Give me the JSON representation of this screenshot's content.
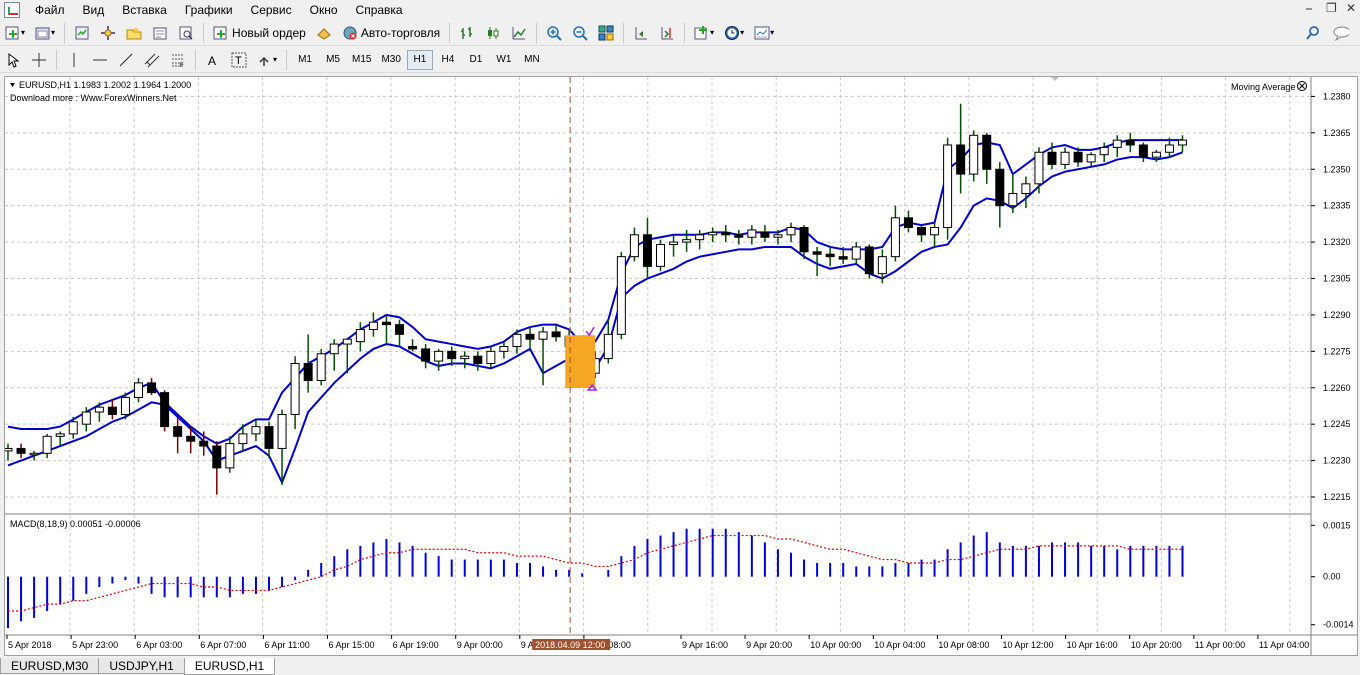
{
  "menu": [
    "Файл",
    "Вид",
    "Вставка",
    "Графики",
    "Сервис",
    "Окно",
    "Справка"
  ],
  "toolbar": {
    "new_order_label": "Новый ордер",
    "auto_trading_label": "Авто-торговля"
  },
  "timeframes": [
    "M1",
    "M5",
    "M15",
    "M30",
    "H1",
    "H4",
    "D1",
    "W1",
    "MN"
  ],
  "active_timeframe": "H1",
  "chart": {
    "symbol_header": "EURUSD,H1  1.1983 1.2002 1.1964 1.2000",
    "download_note": "Download more : Www.ForexWinners.Net",
    "indicator_name": "Moving Average",
    "price_ticks": [
      "1.2380",
      "1.2365",
      "1.2350",
      "1.2335",
      "1.2320",
      "1.2305",
      "1.2290",
      "1.2275",
      "1.2260",
      "1.2245",
      "1.2230",
      "1.2215"
    ],
    "macd_label": "MACD(8,18,9) 0.00051 -0.00006",
    "macd_ticks": [
      "0.0015",
      "0.00",
      "-0.0014"
    ],
    "time_labels": [
      "5 Apr 2018",
      "5 Apr 23:00",
      "6 Apr 03:00",
      "6 Apr 07:00",
      "6 Apr 11:00",
      "6 Apr 15:00",
      "6 Apr 19:00",
      "9 Apr 00:00",
      "9 Apr 04:00",
      "9 Apr 08:00",
      "9 Apr 16:00",
      "9 Apr 20:00",
      "10 Apr 00:00",
      "10 Apr 04:00",
      "10 Apr 08:00",
      "10 Apr 12:00",
      "10 Apr 16:00",
      "10 Apr 20:00",
      "11 Apr 00:00",
      "11 Apr 04:00"
    ],
    "cursor_time": "2018.04.09 12:00",
    "colors": {
      "bull": "#ffffff",
      "bear": "#000000",
      "ma": "#0000cc",
      "macd_hist": "#0000dd",
      "macd_signal": "#dd0000",
      "cursor": "#a0522d",
      "marker": "#f5a623"
    }
  },
  "chart_data": {
    "type": "candlestick",
    "price_range": [
      1.2208,
      1.2388
    ],
    "macd_range": [
      -0.0017,
      0.0018
    ],
    "candles": [
      [
        1.2234,
        1.2237,
        1.223,
        1.2235
      ],
      [
        1.2235,
        1.2237,
        1.2231,
        1.2233
      ],
      [
        1.2233,
        1.2234,
        1.223,
        1.2233
      ],
      [
        1.2233,
        1.2241,
        1.2231,
        1.224
      ],
      [
        1.224,
        1.2242,
        1.2236,
        1.2241
      ],
      [
        1.2241,
        1.2248,
        1.2239,
        1.2246
      ],
      [
        1.2245,
        1.2252,
        1.2242,
        1.225
      ],
      [
        1.225,
        1.2254,
        1.2246,
        1.2252
      ],
      [
        1.2252,
        1.2255,
        1.2247,
        1.2249
      ],
      [
        1.2249,
        1.2258,
        1.2247,
        1.2256
      ],
      [
        1.2256,
        1.2264,
        1.2254,
        1.2262
      ],
      [
        1.2262,
        1.2264,
        1.2257,
        1.2258
      ],
      [
        1.2258,
        1.2259,
        1.2242,
        1.2244
      ],
      [
        1.2244,
        1.2248,
        1.2233,
        1.224
      ],
      [
        1.224,
        1.2244,
        1.2233,
        1.2238
      ],
      [
        1.2238,
        1.2242,
        1.2232,
        1.2236
      ],
      [
        1.2236,
        1.2238,
        1.2216,
        1.2227
      ],
      [
        1.2227,
        1.224,
        1.2225,
        1.2237
      ],
      [
        1.2237,
        1.2245,
        1.2234,
        1.2241
      ],
      [
        1.2241,
        1.2247,
        1.2238,
        1.2244
      ],
      [
        1.2244,
        1.2246,
        1.2231,
        1.2235
      ],
      [
        1.2235,
        1.2251,
        1.222,
        1.2249
      ],
      [
        1.2249,
        1.2273,
        1.2243,
        1.227
      ],
      [
        1.227,
        1.2282,
        1.2258,
        1.2263
      ],
      [
        1.2263,
        1.2276,
        1.2261,
        1.2274
      ],
      [
        1.2274,
        1.228,
        1.2267,
        1.2278
      ],
      [
        1.2278,
        1.228,
        1.2266,
        1.228
      ],
      [
        1.2279,
        1.2287,
        1.2275,
        1.2284
      ],
      [
        1.2284,
        1.2291,
        1.2281,
        1.2287
      ],
      [
        1.2287,
        1.229,
        1.2278,
        1.2286
      ],
      [
        1.2286,
        1.2288,
        1.2277,
        1.2282
      ],
      [
        1.2277,
        1.228,
        1.2275,
        1.2276
      ],
      [
        1.2276,
        1.2278,
        1.2268,
        1.2271
      ],
      [
        1.2271,
        1.2276,
        1.2267,
        1.2275
      ],
      [
        1.2275,
        1.2277,
        1.2269,
        1.2272
      ],
      [
        1.2272,
        1.2275,
        1.2268,
        1.2273
      ],
      [
        1.2273,
        1.2275,
        1.2267,
        1.227
      ],
      [
        1.227,
        1.2277,
        1.2268,
        1.2275
      ],
      [
        1.2275,
        1.2279,
        1.2272,
        1.2277
      ],
      [
        1.2277,
        1.2284,
        1.2274,
        1.2282
      ],
      [
        1.2282,
        1.2285,
        1.2276,
        1.228
      ],
      [
        1.228,
        1.2285,
        1.2261,
        1.2283
      ],
      [
        1.2283,
        1.2286,
        1.2279,
        1.2281
      ],
      [
        1.2281,
        1.2284,
        1.2276,
        1.2277
      ],
      [
        1.2279,
        1.228,
        1.2264,
        1.2266
      ],
      [
        1.2266,
        1.2275,
        1.2264,
        1.2272
      ],
      [
        1.2272,
        1.2288,
        1.227,
        1.2282
      ],
      [
        1.2282,
        1.2316,
        1.228,
        1.2314
      ],
      [
        1.2314,
        1.2326,
        1.2312,
        1.2323
      ],
      [
        1.2323,
        1.233,
        1.2305,
        1.231
      ],
      [
        1.231,
        1.2321,
        1.2308,
        1.2319
      ],
      [
        1.2319,
        1.2323,
        1.2314,
        1.232
      ],
      [
        1.232,
        1.2325,
        1.2316,
        1.2321
      ],
      [
        1.2321,
        1.2325,
        1.2317,
        1.2323
      ],
      [
        1.2323,
        1.2326,
        1.232,
        1.2324
      ],
      [
        1.2324,
        1.2327,
        1.232,
        1.2323
      ],
      [
        1.2323,
        1.2325,
        1.2319,
        1.2322
      ],
      [
        1.2322,
        1.2327,
        1.2319,
        1.2325
      ],
      [
        1.2324,
        1.2327,
        1.232,
        1.2322
      ],
      [
        1.2322,
        1.2325,
        1.2319,
        1.2323
      ],
      [
        1.2323,
        1.2328,
        1.232,
        1.2326
      ],
      [
        1.2326,
        1.2327,
        1.2313,
        1.2316
      ],
      [
        1.2316,
        1.2318,
        1.2306,
        1.2315
      ],
      [
        1.2315,
        1.2318,
        1.231,
        1.2314
      ],
      [
        1.2314,
        1.2318,
        1.2311,
        1.2313
      ],
      [
        1.2313,
        1.232,
        1.2311,
        1.2318
      ],
      [
        1.2318,
        1.2319,
        1.2305,
        1.2307
      ],
      [
        1.2307,
        1.2317,
        1.2303,
        1.2314
      ],
      [
        1.2314,
        1.2335,
        1.2312,
        1.233
      ],
      [
        1.233,
        1.2333,
        1.2324,
        1.2326
      ],
      [
        1.2326,
        1.2327,
        1.232,
        1.2323
      ],
      [
        1.2323,
        1.2328,
        1.2318,
        1.2326
      ],
      [
        1.2326,
        1.2363,
        1.2321,
        1.236
      ],
      [
        1.236,
        1.2377,
        1.234,
        1.2348
      ],
      [
        1.2348,
        1.2366,
        1.2345,
        1.2364
      ],
      [
        1.2364,
        1.2365,
        1.2344,
        1.235
      ],
      [
        1.235,
        1.2353,
        1.2326,
        1.2335
      ],
      [
        1.2335,
        1.2348,
        1.2332,
        1.234
      ],
      [
        1.234,
        1.2347,
        1.2334,
        1.2344
      ],
      [
        1.2344,
        1.2359,
        1.234,
        1.2357
      ],
      [
        1.2357,
        1.2361,
        1.235,
        1.2352
      ],
      [
        1.2352,
        1.2359,
        1.235,
        1.2357
      ],
      [
        1.2357,
        1.2359,
        1.2351,
        1.2353
      ],
      [
        1.2353,
        1.2357,
        1.2351,
        1.2356
      ],
      [
        1.2356,
        1.2361,
        1.2353,
        1.2359
      ],
      [
        1.2359,
        1.2364,
        1.2355,
        1.2362
      ],
      [
        1.2362,
        1.2365,
        1.2357,
        1.236
      ],
      [
        1.236,
        1.2361,
        1.2353,
        1.2355
      ],
      [
        1.2355,
        1.2358,
        1.2353,
        1.2357
      ],
      [
        1.2357,
        1.2363,
        1.2355,
        1.236
      ],
      [
        1.236,
        1.2364,
        1.2357,
        1.2362
      ]
    ],
    "ma_upper": [
      1.2244,
      1.2243,
      1.2243,
      1.2243,
      1.2244,
      1.2247,
      1.225,
      1.2253,
      1.2255,
      1.2257,
      1.226,
      1.2262,
      1.2254,
      1.2249,
      1.2244,
      1.224,
      1.2237,
      1.2239,
      1.2244,
      1.2247,
      1.2247,
      1.2258,
      1.2264,
      1.227,
      1.2273,
      1.2276,
      1.228,
      1.2284,
      1.2287,
      1.229,
      1.2289,
      1.2285,
      1.228,
      1.2279,
      1.2278,
      1.2277,
      1.2276,
      1.2277,
      1.2279,
      1.2283,
      1.2285,
      1.2286,
      1.2286,
      1.2284,
      1.2278,
      1.2279,
      1.2288,
      1.2307,
      1.2318,
      1.2321,
      1.2322,
      1.2323,
      1.2323,
      1.2323,
      1.2324,
      1.2324,
      1.2323,
      1.2324,
      1.2324,
      1.2324,
      1.2326,
      1.2325,
      1.232,
      1.2318,
      1.2317,
      1.2317,
      1.2317,
      1.2318,
      1.2326,
      1.2328,
      1.2327,
      1.2328,
      1.235,
      1.2354,
      1.236,
      1.2361,
      1.236,
      1.2348,
      1.2352,
      1.2356,
      1.2359,
      1.236,
      1.2358,
      1.2358,
      1.2359,
      1.2361,
      1.2362,
      1.2362,
      1.2362,
      1.2362,
      1.2362
    ],
    "ma_lower": [
      1.2228,
      1.223,
      1.2232,
      1.2234,
      1.2236,
      1.2238,
      1.224,
      1.2243,
      1.2246,
      1.2248,
      1.2251,
      1.2254,
      1.2253,
      1.2248,
      1.2243,
      1.2238,
      1.223,
      1.2232,
      1.2234,
      1.2236,
      1.2232,
      1.2221,
      1.2235,
      1.225,
      1.2256,
      1.2262,
      1.2267,
      1.2272,
      1.2276,
      1.2278,
      1.2277,
      1.2274,
      1.2271,
      1.2269,
      1.227,
      1.227,
      1.2269,
      1.2268,
      1.227,
      1.2273,
      1.2276,
      1.2266,
      1.2269,
      1.2272,
      1.2265,
      1.2268,
      1.2277,
      1.2297,
      1.2302,
      1.2305,
      1.2307,
      1.2309,
      1.2312,
      1.2314,
      1.2315,
      1.2316,
      1.2317,
      1.2317,
      1.2318,
      1.2318,
      1.2318,
      1.2314,
      1.2311,
      1.2309,
      1.231,
      1.2311,
      1.2307,
      1.2305,
      1.2308,
      1.2312,
      1.2316,
      1.2318,
      1.2319,
      1.2326,
      1.2335,
      1.2338,
      1.2337,
      1.2334,
      1.2338,
      1.2343,
      1.2347,
      1.2349,
      1.235,
      1.2351,
      1.2352,
      1.2354,
      1.2355,
      1.2355,
      1.2354,
      1.2355,
      1.2357
    ],
    "macd_hist": [
      -0.0015,
      -0.0013,
      -0.0012,
      -0.001,
      -0.0008,
      -0.0007,
      -0.0005,
      -0.0003,
      -0.0002,
      -0.0001,
      -0.0002,
      -0.0005,
      -0.0006,
      -0.0006,
      -0.0006,
      -0.0006,
      -0.0006,
      -0.0006,
      -0.0005,
      -0.0005,
      -0.0004,
      -0.0003,
      -0.0001,
      0.0002,
      0.0004,
      0.0006,
      0.0008,
      0.0009,
      0.001,
      0.0011,
      0.001,
      0.0009,
      0.0007,
      0.0006,
      0.0005,
      0.0005,
      0.0005,
      0.0005,
      0.0005,
      0.0004,
      0.0004,
      0.0003,
      0.0002,
      0.0002,
      0.0001,
      0.0,
      0.0002,
      0.0006,
      0.0009,
      0.0011,
      0.0012,
      0.0013,
      0.0014,
      0.0014,
      0.0014,
      0.0014,
      0.0013,
      0.0012,
      0.001,
      0.0008,
      0.0007,
      0.0005,
      0.0004,
      0.0004,
      0.0004,
      0.0003,
      0.0003,
      0.0003,
      0.0004,
      0.0004,
      0.0005,
      0.0005,
      0.0008,
      0.001,
      0.0012,
      0.0013,
      0.001,
      0.0009,
      0.0009,
      0.0009,
      0.001,
      0.001,
      0.001,
      0.0009,
      0.0009,
      0.0008,
      0.0009,
      0.0009,
      0.0009,
      0.0009,
      0.0009
    ],
    "macd_signal": [
      -0.001,
      -0.001,
      -0.0009,
      -0.0008,
      -0.0008,
      -0.0007,
      -0.0007,
      -0.0006,
      -0.0005,
      -0.0004,
      -0.0003,
      -0.0002,
      -0.0002,
      -0.0002,
      -0.0002,
      -0.0003,
      -0.0003,
      -0.0004,
      -0.0004,
      -0.0004,
      -0.0004,
      -0.0003,
      -0.0002,
      -0.0001,
      0.0,
      0.0002,
      0.0003,
      0.0005,
      0.0006,
      0.0007,
      0.0007,
      0.0008,
      0.0008,
      0.0008,
      0.0008,
      0.0008,
      0.0007,
      0.0007,
      0.0007,
      0.0006,
      0.0006,
      0.0006,
      0.0005,
      0.0004,
      0.0004,
      0.0003,
      0.0003,
      0.0004,
      0.0005,
      0.0007,
      0.0008,
      0.0009,
      0.001,
      0.0011,
      0.0012,
      0.0012,
      0.0012,
      0.0012,
      0.0012,
      0.0011,
      0.0011,
      0.001,
      0.0009,
      0.0008,
      0.0008,
      0.0007,
      0.0006,
      0.0005,
      0.0005,
      0.0004,
      0.0004,
      0.0004,
      0.0005,
      0.0005,
      0.0006,
      0.0007,
      0.0008,
      0.0008,
      0.0008,
      0.0009,
      0.0009,
      0.0009,
      0.0009,
      0.0009,
      0.0009,
      0.0009,
      0.0008,
      0.0008,
      0.0008,
      0.0008,
      0.0008
    ],
    "cursor_index": 43,
    "marker_index": 44
  },
  "tabs": [
    "EURUSD,M30",
    "USDJPY,H1",
    "EURUSD,H1"
  ],
  "active_tab": "EURUSD,H1"
}
